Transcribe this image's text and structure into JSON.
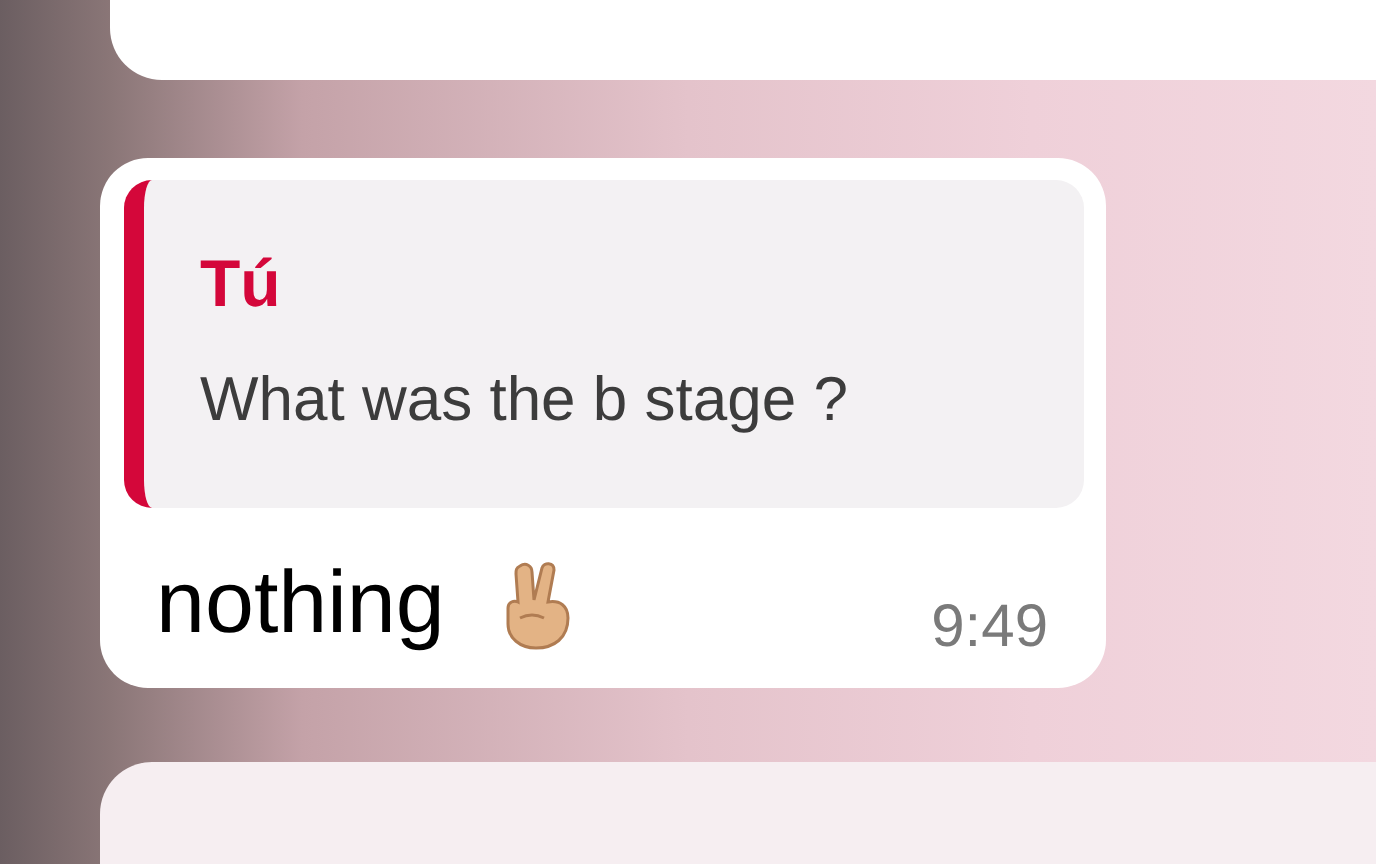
{
  "message": {
    "quote": {
      "author": "Tú",
      "text": "What was the b stage ?"
    },
    "text": "nothing",
    "time": "9:49"
  }
}
